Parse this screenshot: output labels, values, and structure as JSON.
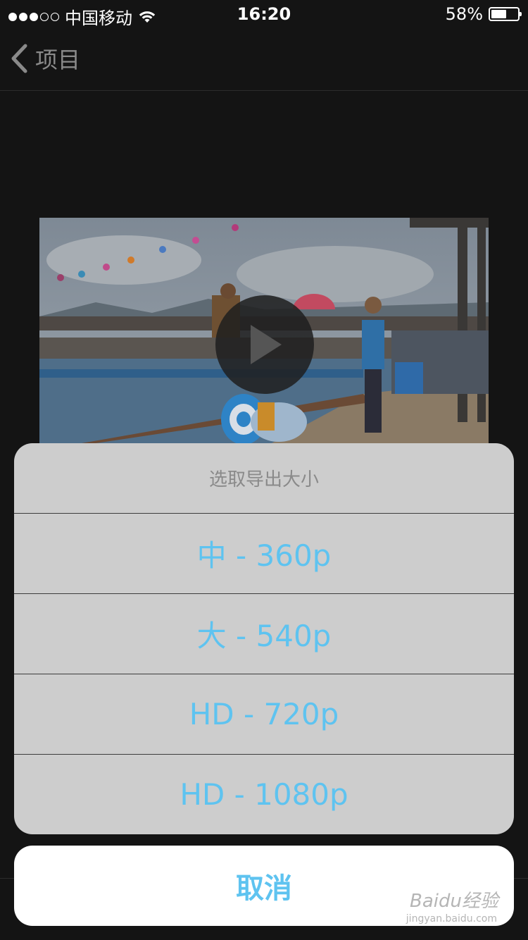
{
  "status_bar": {
    "carrier": "中国移动",
    "time": "16:20",
    "battery_percent": "58%",
    "battery_level": 0.58,
    "signal_bars": 3,
    "signal_total": 5,
    "icons": [
      "signal-dots-icon",
      "wifi-icon",
      "battery-icon"
    ]
  },
  "nav": {
    "back_label": "项目",
    "back_icon": "chevron-left-icon"
  },
  "video": {
    "play_icon": "play-icon"
  },
  "action_sheet": {
    "title": "选取导出大小",
    "options": [
      {
        "label": "中 - 360p"
      },
      {
        "label": "大 - 540p"
      },
      {
        "label": "HD - 720p"
      },
      {
        "label": "HD - 1080p"
      }
    ],
    "cancel_label": "取消"
  },
  "colors": {
    "accent": "#5ec3f0",
    "background": "#141414",
    "sheet": "#d4d4d4"
  },
  "watermark": {
    "text": "Baidu经验",
    "sub": "jingyan.baidu.com"
  }
}
